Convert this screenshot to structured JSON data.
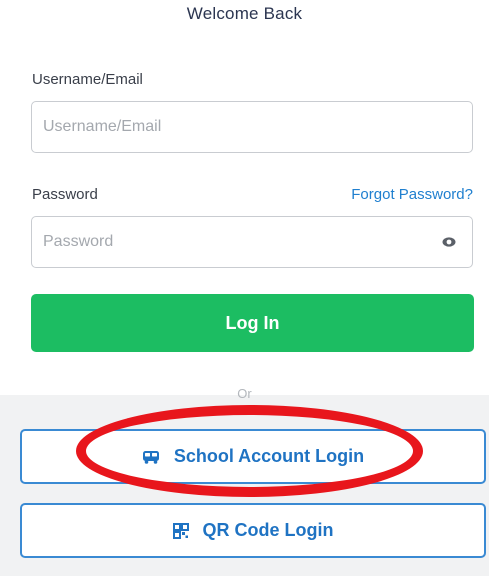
{
  "header": {
    "title": "Welcome Back"
  },
  "form": {
    "username": {
      "label": "Username/Email",
      "placeholder": "Username/Email",
      "value": ""
    },
    "password": {
      "label": "Password",
      "placeholder": "Password",
      "value": "",
      "forgot_label": "Forgot Password?",
      "toggle_icon": "eye-icon"
    },
    "login_label": "Log In"
  },
  "divider": {
    "text": "Or"
  },
  "alternatives": {
    "school": {
      "label": "School Account Login",
      "icon": "bus-icon"
    },
    "qr": {
      "label": "QR Code Login",
      "icon": "qr-code-icon"
    }
  },
  "annotation": {
    "type": "circle-highlight",
    "target": "School Account Login",
    "color": "#e8161c"
  },
  "colors": {
    "primary_green": "#1cbd62",
    "link_blue": "#1f7fcf",
    "outline_blue": "#3a8ad3",
    "highlight_red": "#e8161c"
  }
}
